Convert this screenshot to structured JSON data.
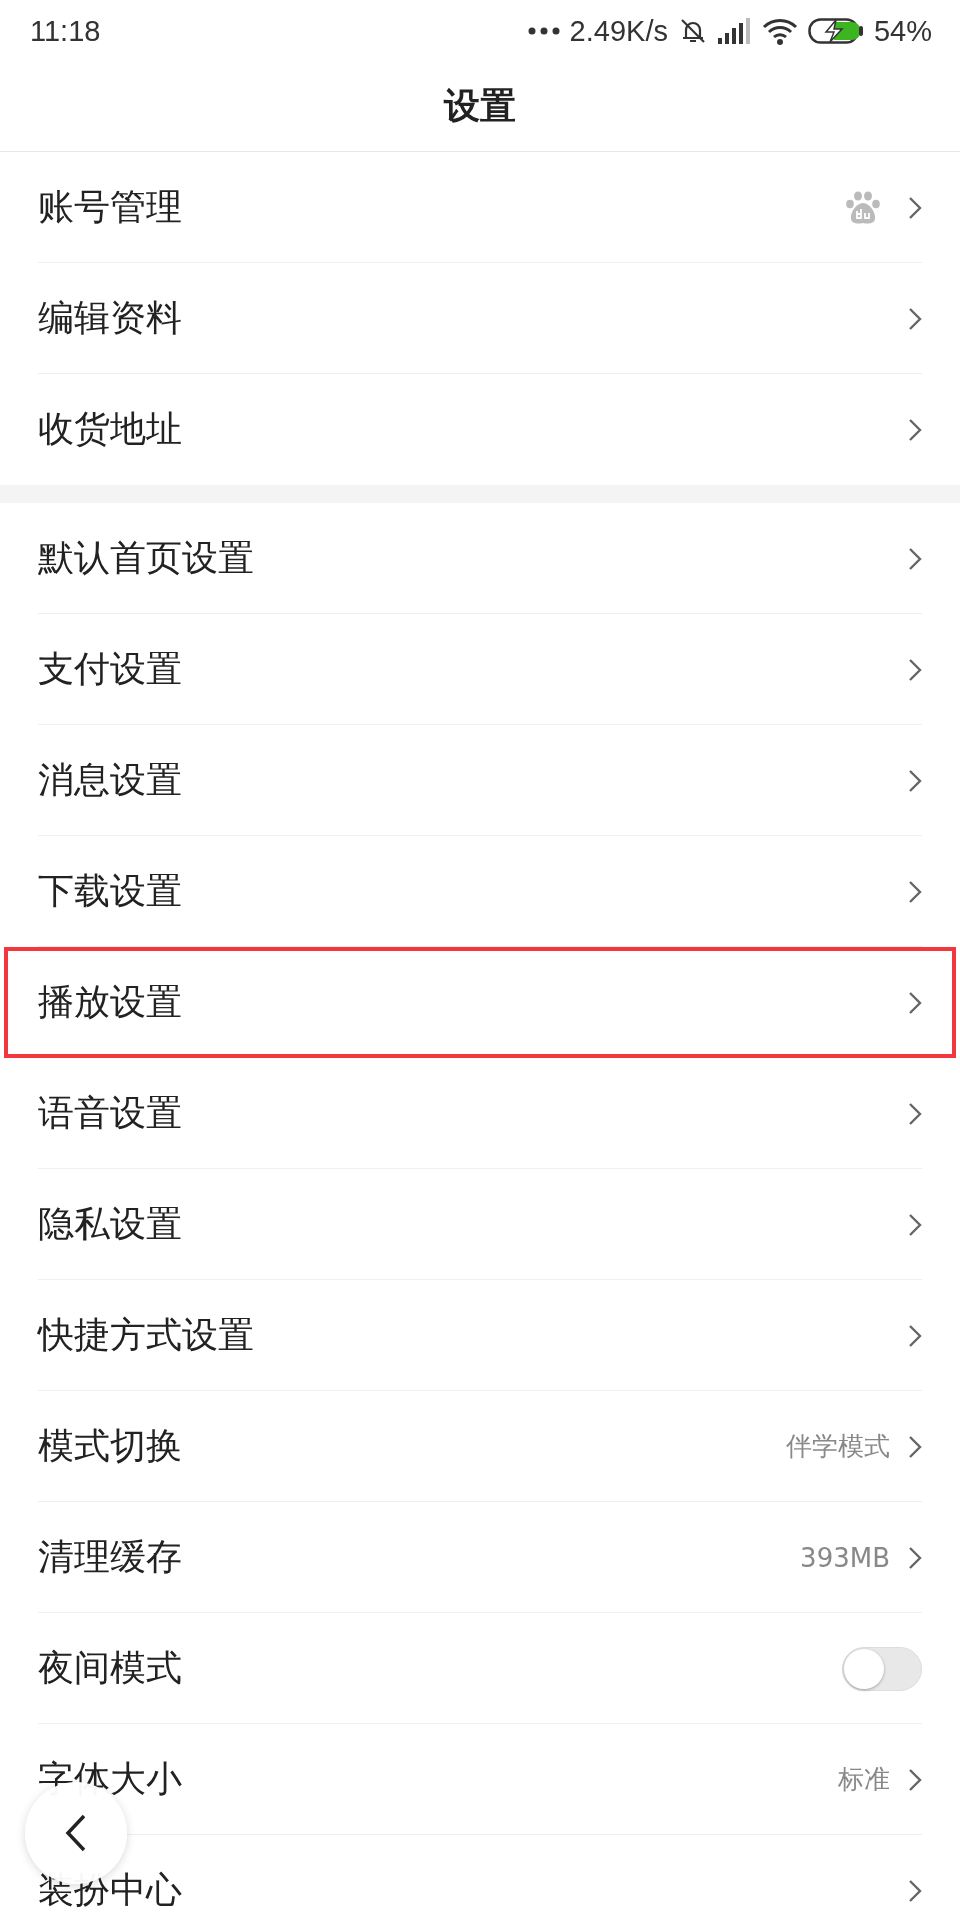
{
  "status_bar": {
    "time": "11:18",
    "speed": "2.49K/s",
    "battery": "54%"
  },
  "title": "设置",
  "groups": [
    {
      "rows": [
        {
          "kind": "account",
          "label": "账号管理",
          "highlighted": false
        },
        {
          "kind": "link",
          "label": "编辑资料",
          "highlighted": false
        },
        {
          "kind": "link",
          "label": "收货地址",
          "highlighted": false
        }
      ]
    },
    {
      "rows": [
        {
          "kind": "link",
          "label": "默认首页设置",
          "highlighted": false
        },
        {
          "kind": "link",
          "label": "支付设置",
          "highlighted": false
        },
        {
          "kind": "link",
          "label": "消息设置",
          "highlighted": false
        },
        {
          "kind": "link",
          "label": "下载设置",
          "highlighted": false
        },
        {
          "kind": "link",
          "label": "播放设置",
          "highlighted": true
        },
        {
          "kind": "link",
          "label": "语音设置",
          "highlighted": false
        },
        {
          "kind": "link",
          "label": "隐私设置",
          "highlighted": false
        },
        {
          "kind": "link",
          "label": "快捷方式设置",
          "highlighted": false
        },
        {
          "kind": "link",
          "label": "模式切换",
          "value": "伴学模式",
          "highlighted": false
        },
        {
          "kind": "link",
          "label": "清理缓存",
          "value": "393MB",
          "highlighted": false
        },
        {
          "kind": "toggle",
          "label": "夜间模式",
          "on": false,
          "highlighted": false
        },
        {
          "kind": "link",
          "label": "字体大小",
          "value": "标准",
          "highlighted": false
        },
        {
          "kind": "link",
          "label": "装扮中心",
          "highlighted": false
        }
      ]
    }
  ]
}
